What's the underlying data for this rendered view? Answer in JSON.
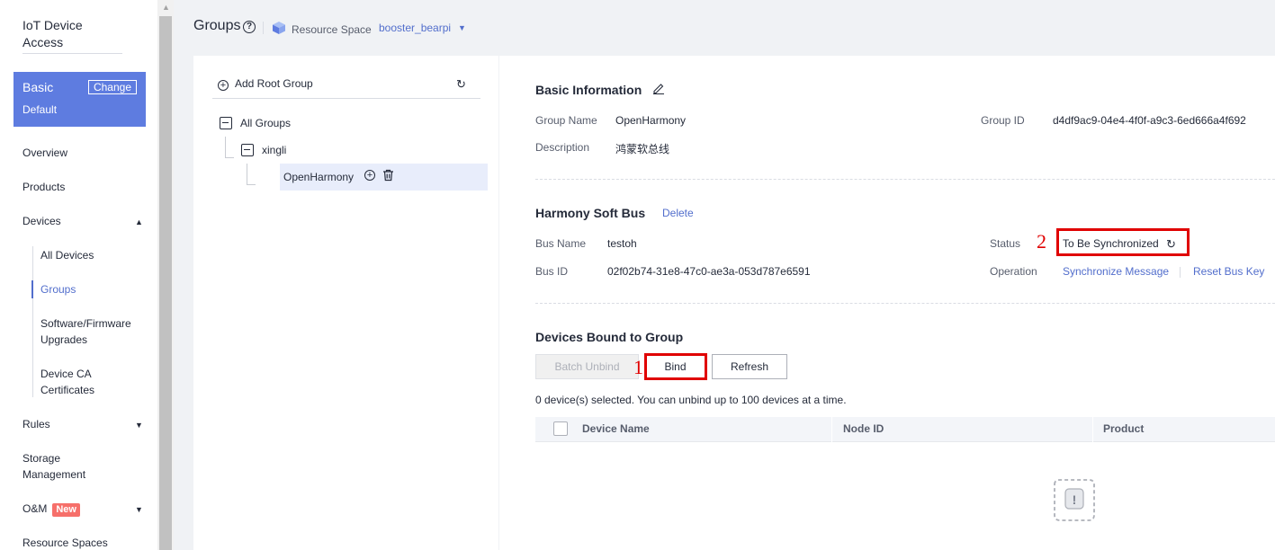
{
  "sidebar": {
    "brand": "IoT Device Access",
    "edition": {
      "name": "Basic",
      "sub": "Default",
      "change_label": "Change"
    },
    "items": [
      {
        "label": "Overview"
      },
      {
        "label": "Products"
      },
      {
        "label": "Devices"
      },
      {
        "label": "All Devices"
      },
      {
        "label": "Groups"
      },
      {
        "label": "Software/Firmware Upgrades"
      },
      {
        "label": "Device CA Certificates"
      },
      {
        "label": "Rules"
      },
      {
        "label": "Storage Management"
      },
      {
        "label": "O&M",
        "badge": "New"
      },
      {
        "label": "Resource Spaces"
      }
    ]
  },
  "header": {
    "title": "Groups",
    "resource_space_label": "Resource Space",
    "resource_space_value": "booster_bearpi"
  },
  "tree": {
    "add_root_label": "Add Root Group",
    "nodes": [
      "All Groups",
      "xingli",
      "OpenHarmony"
    ]
  },
  "basic_info": {
    "title": "Basic Information",
    "group_name_label": "Group Name",
    "group_name": "OpenHarmony",
    "description_label": "Description",
    "description": "鸿蒙软总线",
    "group_id_label": "Group ID",
    "group_id": "d4df9ac9-04e4-4f0f-a9c3-6ed666a4f692"
  },
  "soft_bus": {
    "title": "Harmony Soft Bus",
    "delete_label": "Delete",
    "bus_name_label": "Bus Name",
    "bus_name": "testoh",
    "bus_id_label": "Bus ID",
    "bus_id": "02f02b74-31e8-47c0-ae3a-053d787e6591",
    "status_label": "Status",
    "status": "To Be Synchronized",
    "operation_label": "Operation",
    "sync_label": "Synchronize Message",
    "reset_label": "Reset Bus Key"
  },
  "devices": {
    "title": "Devices Bound to Group",
    "batch_unbind_label": "Batch Unbind",
    "bind_label": "Bind",
    "refresh_label": "Refresh",
    "hint": "0 device(s) selected. You can unbind up to 100 devices at a time.",
    "columns": [
      "Device Name",
      "Node ID",
      "Product"
    ]
  },
  "annotations": [
    "1",
    "2"
  ],
  "colors": {
    "accent": "#526ecc",
    "edition_bg": "#5e7ce0",
    "annotation": "#e00000"
  }
}
